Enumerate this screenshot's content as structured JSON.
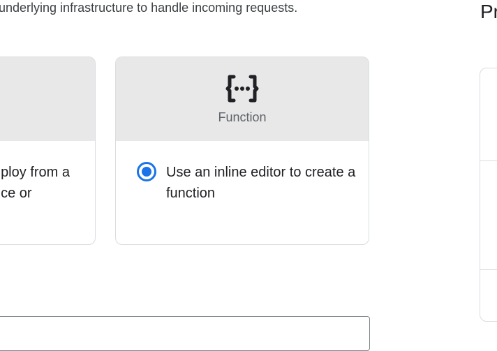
{
  "intro_text": "underlying infrastructure to handle incoming requests.",
  "side_heading": "Pr",
  "cards": {
    "left": {
      "description": "ploy from a\nce or"
    },
    "right": {
      "title": "Function",
      "icon": "function-braces-icon",
      "description": "Use an inline editor to create a function",
      "selected": true
    }
  },
  "colors": {
    "accent": "#1a73e8",
    "card_header_bg": "#e8e8e8",
    "border": "#dadce0"
  }
}
